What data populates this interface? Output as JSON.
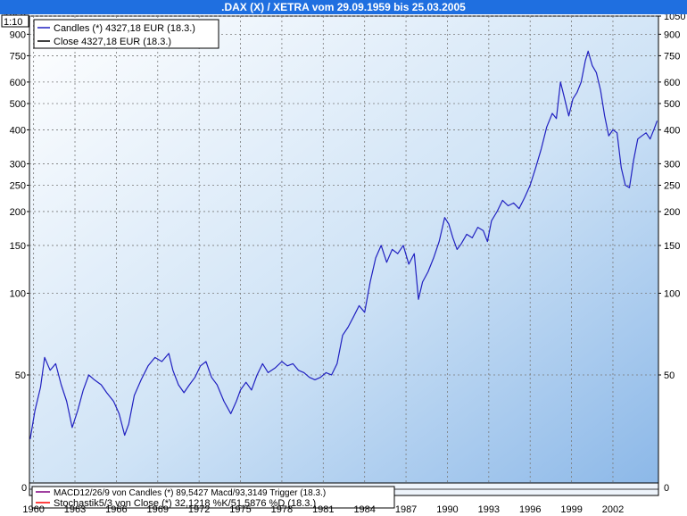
{
  "title": ".DAX (X) / XETRA vom 29.09.1959 bis 25.03.2005",
  "zoom_label": "1:10",
  "legend": [
    {
      "label": "Candles (*) 4327,18 EUR (18.3.)",
      "color": "#2020c0"
    },
    {
      "label": "Close 4327,18 EUR (18.3.)",
      "color": "#000000"
    }
  ],
  "indicator_legend": [
    {
      "label": "MACD12/26/9 von Candles (*) 89,5427 Macd/93,3149 Trigger (18.3.)",
      "color": "#800080"
    },
    {
      "label": "Stochastik5/3 von Close (*) 32,1218 %K/51,5876 %D (18.3.)",
      "color": "#ff0000"
    }
  ],
  "chart_data": {
    "type": "line",
    "title": ".DAX (X) / XETRA vom 29.09.1959 bis 25.03.2005",
    "y_scale": "log",
    "ylim": [
      20,
      1050
    ],
    "xlim": [
      1959.7,
      2005.3
    ],
    "y_ticks": [
      50,
      100,
      150,
      200,
      250,
      300,
      400,
      500,
      600,
      750,
      900,
      1050
    ],
    "y_ticks_right": [
      50,
      100,
      150,
      200,
      250,
      300,
      400,
      500,
      600,
      750,
      900,
      1050
    ],
    "x_tick_labels": [
      "1960",
      "1963",
      "1966",
      "1969",
      "1972",
      "1975",
      "1978",
      "1981",
      "1984",
      "1987",
      "1990",
      "1993",
      "1996",
      "1999",
      "2002"
    ],
    "x_ticks": [
      1960,
      1963,
      1966,
      1969,
      1972,
      1975,
      1978,
      1981,
      1984,
      1987,
      1990,
      1993,
      1996,
      1999,
      2002
    ],
    "grid": true,
    "legend_position": "top-left",
    "series": [
      {
        "name": "Candles (*) 4327,18 EUR (18.3.)",
        "color": "#2020c0",
        "x": [
          1959.75,
          1960.1,
          1960.5,
          1960.8,
          1961.2,
          1961.6,
          1962.0,
          1962.4,
          1962.8,
          1963.2,
          1963.6,
          1964.0,
          1964.4,
          1964.9,
          1965.3,
          1965.8,
          1966.2,
          1966.6,
          1966.9,
          1967.3,
          1967.8,
          1968.3,
          1968.8,
          1969.3,
          1969.8,
          1970.1,
          1970.5,
          1970.9,
          1971.3,
          1971.7,
          1972.1,
          1972.5,
          1972.9,
          1973.3,
          1973.8,
          1974.3,
          1974.7,
          1975.0,
          1975.4,
          1975.8,
          1976.2,
          1976.6,
          1977.0,
          1977.5,
          1978.0,
          1978.4,
          1978.8,
          1979.2,
          1979.6,
          1980.0,
          1980.4,
          1980.8,
          1981.2,
          1981.6,
          1982.0,
          1982.4,
          1982.8,
          1983.2,
          1983.6,
          1984.0,
          1984.4,
          1984.8,
          1985.2,
          1985.6,
          1986.0,
          1986.4,
          1986.8,
          1987.2,
          1987.6,
          1987.9,
          1988.2,
          1988.6,
          1989.0,
          1989.4,
          1989.8,
          1990.1,
          1990.4,
          1990.7,
          1991.0,
          1991.4,
          1991.8,
          1992.2,
          1992.6,
          1992.9,
          1993.2,
          1993.6,
          1994.0,
          1994.4,
          1994.8,
          1995.2,
          1995.6,
          1996.0,
          1996.4,
          1996.8,
          1997.2,
          1997.6,
          1997.9,
          1998.2,
          1998.5,
          1998.8,
          1999.1,
          1999.4,
          1999.7,
          2000.0,
          2000.2,
          2000.5,
          2000.8,
          2001.1,
          2001.4,
          2001.7,
          2002.0,
          2002.3,
          2002.6,
          2002.9,
          2003.2,
          2003.5,
          2003.8,
          2004.1,
          2004.4,
          2004.7,
          2005.0,
          2005.2
        ],
        "y": [
          29,
          37,
          45,
          58,
          52,
          55,
          46,
          40,
          32,
          37,
          44,
          50,
          48,
          46,
          43,
          40,
          36,
          30,
          33,
          42,
          48,
          54,
          58,
          56,
          60,
          52,
          46,
          43,
          46,
          49,
          54,
          56,
          49,
          46,
          40,
          36,
          40,
          44,
          47,
          44,
          50,
          55,
          51,
          53,
          56,
          54,
          55,
          52,
          51,
          49,
          48,
          49,
          51,
          50,
          55,
          70,
          75,
          82,
          90,
          85,
          110,
          135,
          150,
          130,
          145,
          140,
          150,
          128,
          140,
          95,
          110,
          120,
          135,
          155,
          190,
          180,
          160,
          145,
          152,
          165,
          160,
          175,
          170,
          155,
          185,
          200,
          220,
          210,
          215,
          205,
          225,
          250,
          290,
          340,
          410,
          460,
          440,
          600,
          520,
          450,
          520,
          550,
          600,
          720,
          780,
          690,
          650,
          560,
          450,
          380,
          400,
          390,
          290,
          250,
          245,
          310,
          370,
          380,
          390,
          370,
          405,
          432
        ]
      }
    ],
    "indicator_series": [
      {
        "name": "MACD12/26/9 von Candles (*) 89,5427 Macd/93,3149 Trigger (18.3.)"
      },
      {
        "name": "Stochastik5/3 von Close (*) 32,1218 %K/51,5876 %D (18.3.)"
      }
    ],
    "indicator_axis_label": "0"
  }
}
